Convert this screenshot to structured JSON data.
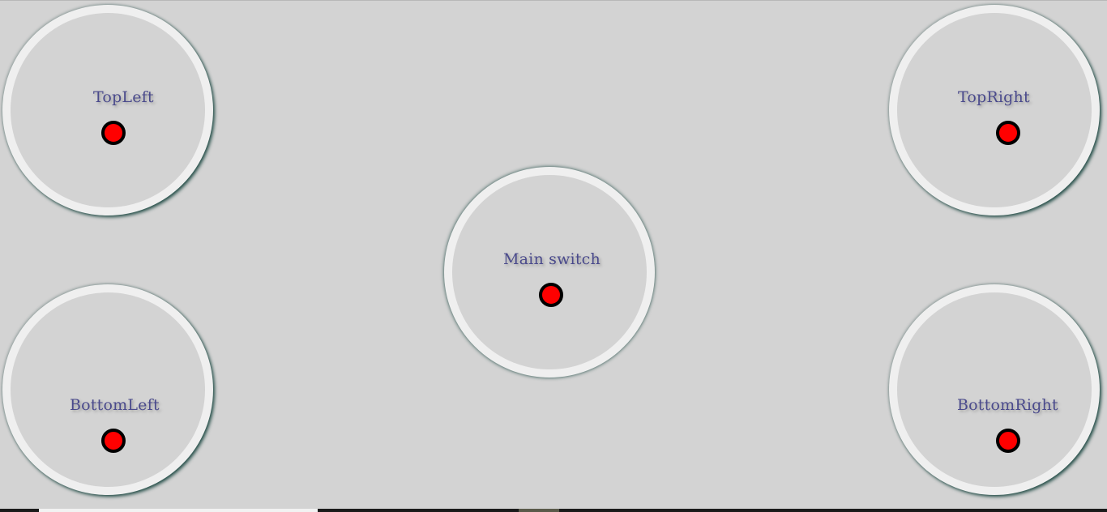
{
  "switches": {
    "top_left": {
      "label": "TopLeft",
      "state_color": "#ff0000"
    },
    "top_right": {
      "label": "TopRight",
      "state_color": "#ff0000"
    },
    "main": {
      "label": "Main switch",
      "state_color": "#ff0000"
    },
    "bottom_left": {
      "label": "BottomLeft",
      "state_color": "#ff0000"
    },
    "bottom_right": {
      "label": "BottomRight",
      "state_color": "#ff0000"
    }
  },
  "colors": {
    "background": "#d3d3d3",
    "ring": "#efefef",
    "label_text": "#4a4a8c",
    "indicator_off": "#ff0000",
    "shadow": "#1f4a44"
  }
}
